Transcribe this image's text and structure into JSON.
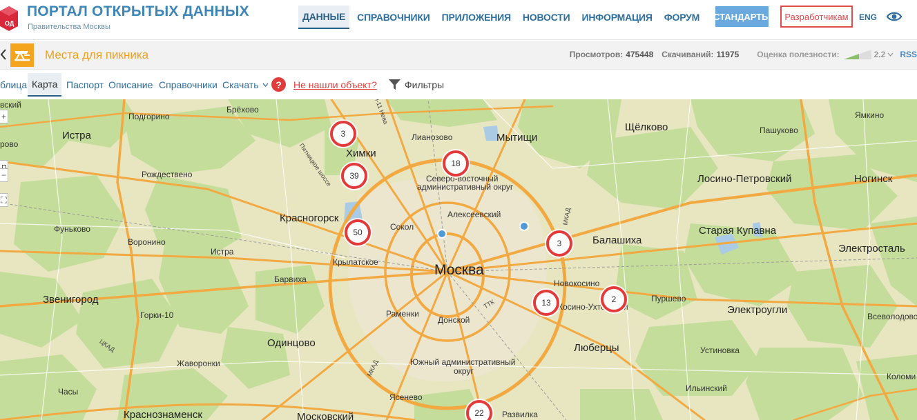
{
  "header": {
    "logo_icon_text": "ОД",
    "title": "ПОРТАЛ ОТКРЫТЫХ ДАННЫХ",
    "subtitle": "Правительства Москвы",
    "nav": [
      {
        "label": "ДАННЫЕ",
        "active": true
      },
      {
        "label": "СПРАВОЧНИКИ",
        "active": false
      },
      {
        "label": "ПРИЛОЖЕНИЯ",
        "active": false
      },
      {
        "label": "НОВОСТИ",
        "active": false
      },
      {
        "label": "ИНФОРМАЦИЯ",
        "active": false
      },
      {
        "label": "ФОРУМ",
        "active": false
      }
    ],
    "standards_label": "СТАНДАРТЫ",
    "developers_label": "Разработчикам",
    "lang_label": "ENG",
    "accessibility_icon": "eye-icon"
  },
  "dataset": {
    "title": "Места для пикника",
    "views_label": "Просмотров:",
    "views_value": "475448",
    "downloads_label": "Скачиваний:",
    "downloads_value": "11975",
    "rating_label": "Оценка полезности:",
    "rating_value": "2.2",
    "rss_label": "RSS"
  },
  "tabs": {
    "table": "блица",
    "map": "Карта",
    "passport": "Паспорт",
    "description": "Описание",
    "references": "Справочники",
    "download": "Скачать",
    "help_mark": "?",
    "not_found": "Не нашли объект?",
    "filters": "Фильтры"
  },
  "map": {
    "controls": {
      "zoom_in": "+",
      "zoom_out": "−",
      "fullscreen": "⛶"
    },
    "side_labels": {
      "top": "вский",
      "mid": "рово"
    },
    "city_labels": {
      "istra": "Истра",
      "khimki": "Химки",
      "mytishchi": "Мытищи",
      "shchelkovo": "Щёлково",
      "krasnogorsk": "Красногорск",
      "losino": "Лосино-Петровский",
      "noginsk": "Ногинск",
      "balashikha": "Балашиха",
      "staraya_kupavna": "Старая Купавна",
      "elektrostal": "Электросталь",
      "zvenigorod": "Звенигород",
      "odintsovo": "Одинцово",
      "lyubertsy": "Люберцы",
      "elektrougli": "Электроугли",
      "krasnoznamensk": "Краснознаменск",
      "moskovsky": "Московский"
    },
    "moscow_label": "Москва",
    "small_labels": {
      "podgorinoe": "Подгорино",
      "brekhovo": "Брёхово",
      "lianozovo": "Лианозово",
      "pashukovo": "Пашуково",
      "yamkino": "Ямкино",
      "rozhdestveno": "Рождествено",
      "nsvao_1": "Северо-восточный",
      "nsvao_2": "административный округ",
      "alekseevsky": "Алексеевский",
      "funkovo": "Фуньково",
      "sokol": "Сокол",
      "voronino": "Воронино",
      "istra2": "Истра",
      "krylatskoe": "Крылатское",
      "barvikha": "Барвиха",
      "novokosino": "Новокосино",
      "kosino": "Косино-Ухтомский",
      "purshevo": "Пуршево",
      "gorki": "Горки-10",
      "ramenki": "Раменки",
      "donskoy": "Донской",
      "vsevolodovo": "Всеволодово",
      "ustinovka": "Устиновка",
      "zhavoronki": "Жаворонки",
      "uao_1": "Южный административный",
      "uao_2": "округ",
      "ilyinsky": "Ильинский",
      "kolomi": "Коломи",
      "chasy": "Часы",
      "yasenevo": "Ясенево",
      "razvilka": "Развилка"
    },
    "road_labels": {
      "m11": "M-11 Нева",
      "pyatnitskoe": "Пятницкое шоссе",
      "mkad_ne": "МКАД",
      "mkad_sw": "МКАД",
      "ttk": "ТТК",
      "tskad": "ЦКАД"
    },
    "clusters": [
      {
        "id": "khimki-north",
        "count": "3"
      },
      {
        "id": "lianozovo",
        "count": "18"
      },
      {
        "id": "khimki-south",
        "count": "39"
      },
      {
        "id": "krasnogorsk",
        "count": "50"
      },
      {
        "id": "balashikha",
        "count": "3"
      },
      {
        "id": "novokosino",
        "count": "2"
      },
      {
        "id": "kosino",
        "count": "13"
      },
      {
        "id": "razvilka",
        "count": "22"
      }
    ]
  }
}
